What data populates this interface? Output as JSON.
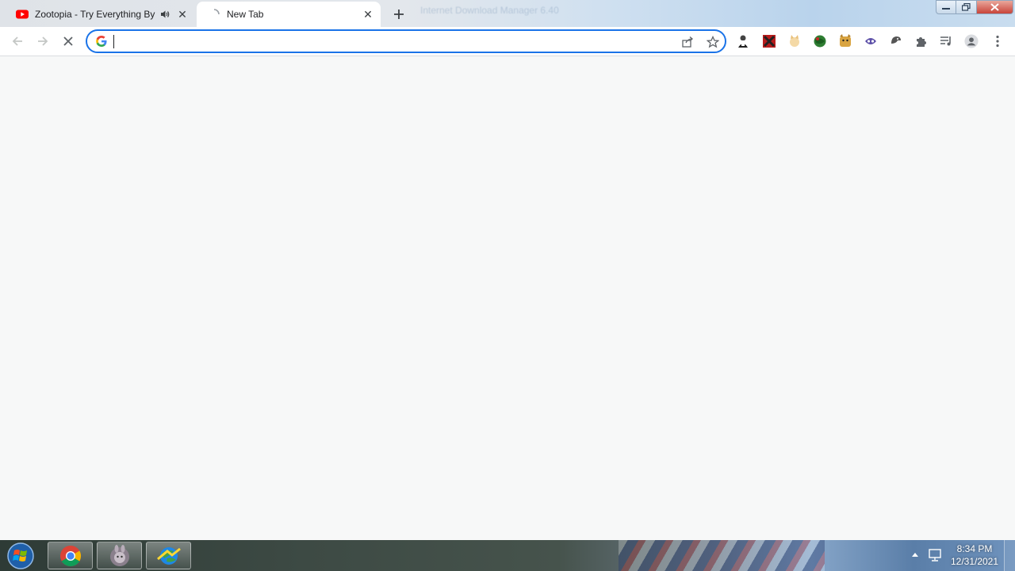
{
  "tabs": [
    {
      "title": "Zootopia - Try Everything By",
      "favicon": "youtube-icon",
      "audio": "speaker-icon",
      "active": false
    },
    {
      "title": "New Tab",
      "favicon": "loading-icon",
      "active": true
    }
  ],
  "background_tab_hint": "Internet Download Manager 6.40",
  "toolbar": {
    "omnibox_value": "",
    "omnibox_icon": "google-icon",
    "extensions": [
      "person-extension-icon",
      "x-extension-icon",
      "cat-extension-icon",
      "globe-extension-icon",
      "dog-extension-icon",
      "robot-extension-icon",
      "fox-extension-icon",
      "puzzle-icon",
      "reading-list-icon",
      "profile-icon",
      "menu-icon"
    ]
  },
  "taskbar": {
    "apps": [
      "chrome-icon",
      "bunny-app-icon",
      "idm-icon"
    ],
    "time": "8:34 PM",
    "date": "12/31/2021"
  },
  "colors": {
    "accent": "#1a73e8",
    "youtube": "#ff0000"
  }
}
